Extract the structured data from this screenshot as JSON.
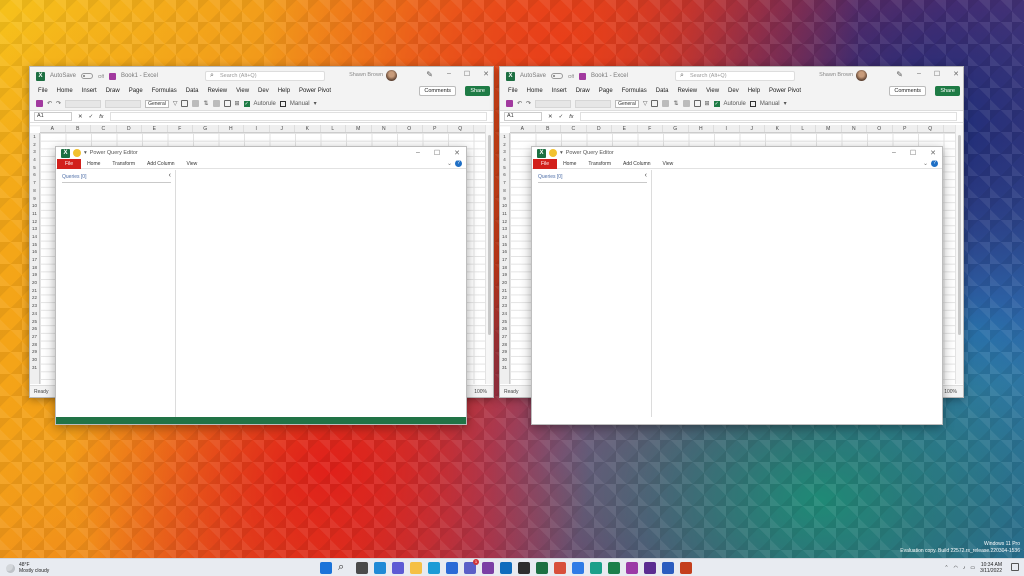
{
  "excel_windows": [
    {
      "autosave": "AutoSave",
      "toggle": "Off",
      "title": "Book1 - Excel",
      "search_placeholder": "Search (Alt+Q)",
      "user": "Shawn Brown",
      "menu": [
        "File",
        "Home",
        "Insert",
        "Draw",
        "Page",
        "Formulas",
        "Data",
        "Review",
        "View",
        "Dev",
        "Help",
        "Power Pivot"
      ],
      "comments": "Comments",
      "share": "Share",
      "number_format": "General",
      "autorule": "Autorule",
      "manual": "Manual",
      "namebox": "A1",
      "status": "Ready",
      "zoom": "100%"
    },
    {
      "autosave": "AutoSave",
      "toggle": "Off",
      "title": "Book1 - Excel",
      "search_placeholder": "Search (Alt+Q)",
      "user": "Shawn Brown",
      "menu": [
        "File",
        "Home",
        "Insert",
        "Draw",
        "Page",
        "Formulas",
        "Data",
        "Review",
        "View",
        "Dev",
        "Help",
        "Power Pivot"
      ],
      "comments": "Comments",
      "share": "Share",
      "number_format": "General",
      "autorule": "Autorule",
      "manual": "Manual",
      "namebox": "A1",
      "status": "Ready",
      "zoom": "100%"
    }
  ],
  "columns": [
    "A",
    "B",
    "C",
    "D",
    "E",
    "F",
    "G",
    "H",
    "I",
    "J",
    "K",
    "L",
    "M",
    "N",
    "O",
    "P",
    "Q"
  ],
  "rows": [
    "1",
    "2",
    "3",
    "4",
    "5",
    "6",
    "7",
    "8",
    "9",
    "10",
    "11",
    "12",
    "13",
    "14",
    "15",
    "16",
    "17",
    "18",
    "19",
    "20",
    "21",
    "22",
    "23",
    "24",
    "25",
    "26",
    "27",
    "28",
    "29",
    "30",
    "31"
  ],
  "pq_windows": [
    {
      "title": "Power Query Editor",
      "tabs": [
        "File",
        "Home",
        "Transform",
        "Add Column",
        "View"
      ],
      "queries_label": "Queries [0]",
      "help": "?"
    },
    {
      "title": "Power Query Editor",
      "tabs": [
        "File",
        "Home",
        "Transform",
        "Add Column",
        "View"
      ],
      "queries_label": "Queries [0]",
      "help": "?"
    }
  ],
  "watermark": {
    "line1": "Windows 11 Pro",
    "line2": "Evaluation copy. Build 22572.rs_release.220304-1536"
  },
  "taskbar": {
    "temp": "48°F",
    "weather": "Mostly cloudy",
    "time": "10:34 AM",
    "date": "3/11/2022",
    "icons": [
      "start-icon",
      "search-icon",
      "task-view-icon",
      "widgets-icon",
      "chat-icon",
      "file-explorer-icon",
      "edge-icon",
      "store-icon",
      "teams-icon",
      "onenote-icon",
      "outlook-icon",
      "terminal-icon",
      "excel-icon",
      "snip-icon",
      "todo-icon",
      "edge-beta-icon",
      "edge-dev-icon",
      "onenote-purple-icon",
      "vs-icon",
      "word-icon",
      "powerpoint-icon"
    ],
    "icon_colors": [
      "#1a73d9",
      "#333333",
      "#4a4a4a",
      "#1f8ad6",
      "#5d5bd4",
      "#f5c045",
      "#1a9bd6",
      "#2b6ad6",
      "#5b5fc7",
      "#7b3fa4",
      "#0f6cbd",
      "#2d2d2d",
      "#1d6f42",
      "#d84f3b",
      "#2f7be6",
      "#1aa08a",
      "#1a7f4a",
      "#9b3aa6",
      "#5c2d91",
      "#2b5cbf",
      "#c43e1c"
    ]
  }
}
